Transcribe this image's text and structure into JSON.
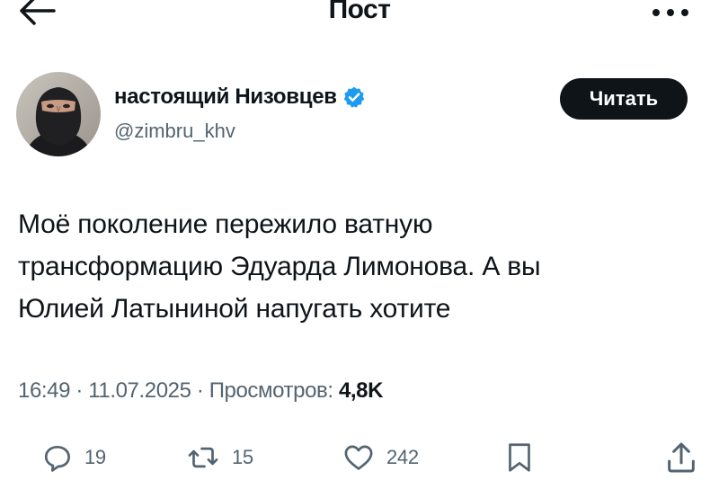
{
  "header": {
    "title": "Пост",
    "back_icon": "arrow-left-icon",
    "more_icon": "more-dots-icon"
  },
  "author": {
    "display_name": "настоящий Низовцев",
    "handle": "@zimbru_khv",
    "verified": true,
    "verified_color": "#1d9bf0",
    "follow_label": "Читать"
  },
  "tweet": {
    "lines": [
      "Моё поколение пережило ватную",
      "трансформацию Эдуарда Лимонова. А вы",
      "Юлией Латыниной напугать хотите"
    ]
  },
  "meta": {
    "time": "16:49",
    "separator": " · ",
    "date": "11.07.2025",
    "views_label": "Просмотров: ",
    "views_count": "4,8K"
  },
  "actions": {
    "replies": {
      "icon": "reply-icon",
      "count": "19"
    },
    "retweets": {
      "icon": "retweet-icon",
      "count": "15"
    },
    "likes": {
      "icon": "heart-icon",
      "count": "242"
    },
    "bookmark": {
      "icon": "bookmark-icon"
    },
    "share": {
      "icon": "share-icon"
    }
  },
  "colors": {
    "text_primary": "#0f1419",
    "text_secondary": "#536471",
    "button_bg": "#0f1419",
    "background": "#ffffff"
  }
}
